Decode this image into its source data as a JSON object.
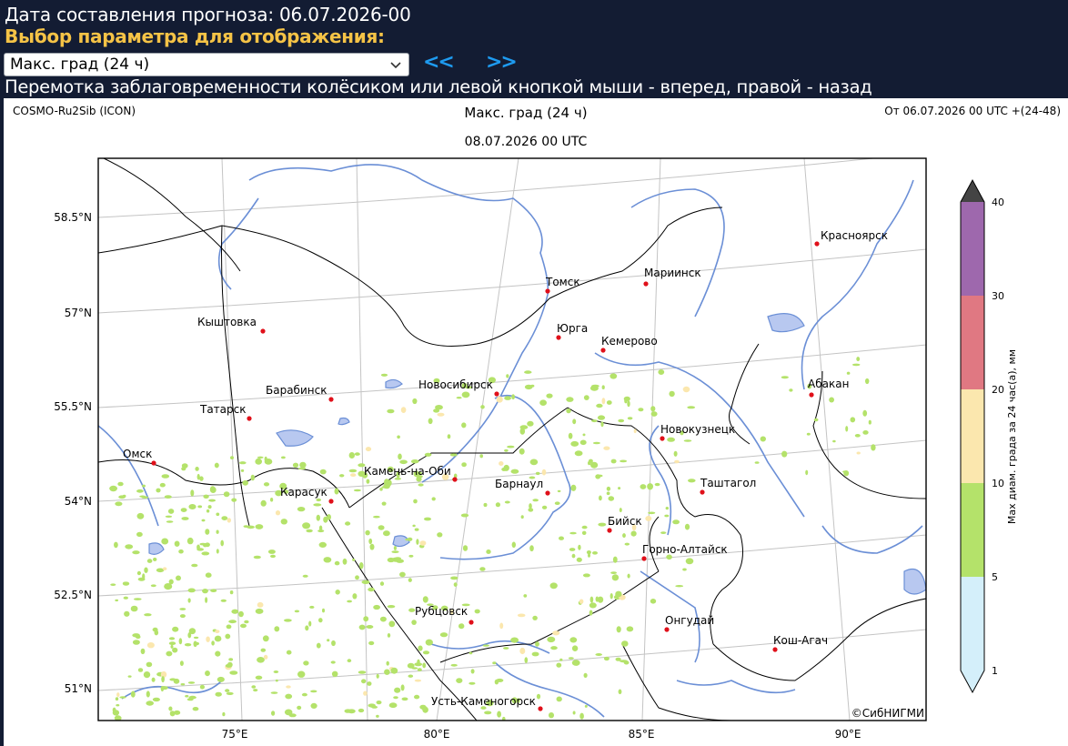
{
  "header": {
    "forecast_date": "Дата составления прогноза: 06.07.2026-00",
    "param_heading": "Выбор параметра для отображения:",
    "selected_param": "Макс. град (24 ч)",
    "nav_back": "<<",
    "nav_forward": ">>",
    "hint": "Перемотка заблаговременности колёсиком или левой кнопкой мыши - вперед, правой - назад"
  },
  "map": {
    "model": "COSMO-Ru2Sib (ICON)",
    "title": "Макс. град (24 ч)",
    "valid_time": "08.07.2026 00 UTC",
    "run_info": "От 06.07.2026 00 UTC +(24-48)",
    "copyright": "©СибНИГМИ",
    "lat_labels": [
      "58.5°N",
      "57°N",
      "55.5°N",
      "54°N",
      "52.5°N",
      "51°N"
    ],
    "lon_labels": [
      "75°E",
      "80°E",
      "85°E",
      "90°E"
    ],
    "cities": [
      {
        "name": "Красноярск"
      },
      {
        "name": "Томск"
      },
      {
        "name": "Мариинск"
      },
      {
        "name": "Кыштовка"
      },
      {
        "name": "Юрга"
      },
      {
        "name": "Кемерово"
      },
      {
        "name": "Барабинск"
      },
      {
        "name": "Новосибирск"
      },
      {
        "name": "Абакан"
      },
      {
        "name": "Татарск"
      },
      {
        "name": "Новокузнецк"
      },
      {
        "name": "Омск"
      },
      {
        "name": "Камень-на-Оби"
      },
      {
        "name": "Барнаул"
      },
      {
        "name": "Таштагол"
      },
      {
        "name": "Карасук"
      },
      {
        "name": "Бийск"
      },
      {
        "name": "Горно-Алтайск"
      },
      {
        "name": "Рубцовск"
      },
      {
        "name": "Онгудай"
      },
      {
        "name": "Кош-Агач"
      },
      {
        "name": "Усть-Каменогорск"
      }
    ]
  },
  "colorbar": {
    "label": "Max диам. града за 24 час(а), мм",
    "ticks": [
      "1",
      "5",
      "10",
      "20",
      "30",
      "40"
    ],
    "colors": [
      "#d4effa",
      "#b4e26a",
      "#fbe7ae",
      "#e07882",
      "#9e68ad",
      "#444444"
    ]
  },
  "colors": {
    "background": "#131c33",
    "heading": "#f5c346",
    "nav": "#1e9bf0",
    "rivers": "#6b8fd6",
    "borders": "#000000",
    "city_marker": "#e0101a"
  }
}
